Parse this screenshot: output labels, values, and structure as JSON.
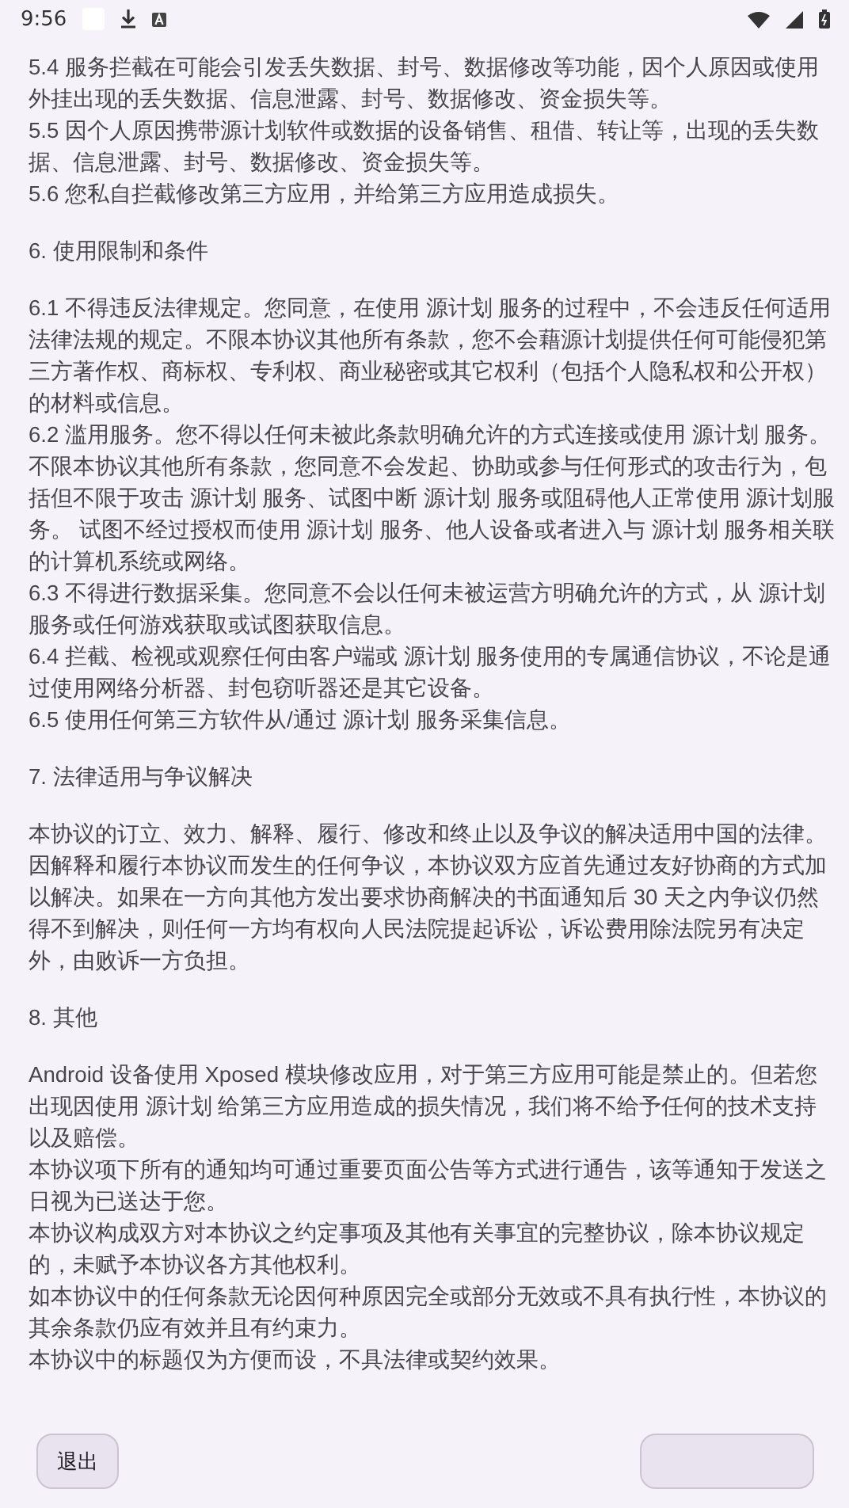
{
  "status_bar": {
    "time": "9:56"
  },
  "intro_paragraphs": [
    "5.4 服务拦截在可能会引发丢失数据、封号、数据修改等功能，因个人原因或使用外挂出现的丢失数据、信息泄露、封号、数据修改、资金损失等。",
    "5.5 因个人原因携带源计划软件或数据的设备销售、租借、转让等，出现的丢失数据、信息泄露、封号、数据修改、资金损失等。",
    "5.6 您私自拦截修改第三方应用，并给第三方应用造成损失。"
  ],
  "sections": [
    {
      "title": "6. 使用限制和条件",
      "paragraphs": [
        "6.1 不得违反法律规定。您同意，在使用 源计划 服务的过程中，不会违反任何适用法律法规的规定。不限本协议其他所有条款，您不会藉源计划提供任何可能侵犯第三方著作权、商标权、专利权、商业秘密或其它权利（包括个人隐私权和公开权）的材料或信息。",
        "6.2 滥用服务。您不得以任何未被此条款明确允许的方式连接或使用 源计划 服务。不限本协议其他所有条款，您同意不会发起、协助或参与任何形式的攻击行为，包括但不限于攻击 源计划 服务、试图中断 源计划 服务或阻碍他人正常使用 源计划服务。 试图不经过授权而使用 源计划 服务、他人设备或者进入与 源计划 服务相关联的计算机系统或网络。",
        "6.3 不得进行数据采集。您同意不会以任何未被运营方明确允许的方式，从 源计划服务或任何游戏获取或试图获取信息。",
        "6.4 拦截、检视或观察任何由客户端或 源计划 服务使用的专属通信协议，不论是通过使用网络分析器、封包窃听器还是其它设备。",
        "6.5 使用任何第三方软件从/通过 源计划 服务采集信息。"
      ]
    },
    {
      "title": "7. 法律适用与争议解决",
      "paragraphs": [
        "本协议的订立、效力、解释、履行、修改和终止以及争议的解决适用中国的法律。因解释和履行本协议而发生的任何争议，本协议双方应首先通过友好协商的方式加以解决。如果在一方向其他方发出要求协商解决的书面通知后 30 天之内争议仍然得不到解决，则任何一方均有权向人民法院提起诉讼，诉讼费用除法院另有决定外，由败诉一方负担。"
      ]
    },
    {
      "title": "8. 其他",
      "paragraphs": [
        "Android 设备使用 Xposed 模块修改应用，对于第三方应用可能是禁止的。但若您出现因使用 源计划 给第三方应用造成的损失情况，我们将不给予任何的技术支持以及赔偿。",
        "本协议项下所有的通知均可通过重要页面公告等方式进行通告，该等通知于发送之日视为已送达于您。",
        "本协议构成双方对本协议之约定事项及其他有关事宜的完整协议，除本协议规定的，未赋予本协议各方其他权利。",
        "如本协议中的任何条款无论因何种原因完全或部分无效或不具有执行性，本协议的其余条款仍应有效并且有约束力。",
        "本协议中的标题仅为方便而设，不具法律或契约效果。"
      ]
    }
  ],
  "buttons": {
    "exit": "退出"
  }
}
